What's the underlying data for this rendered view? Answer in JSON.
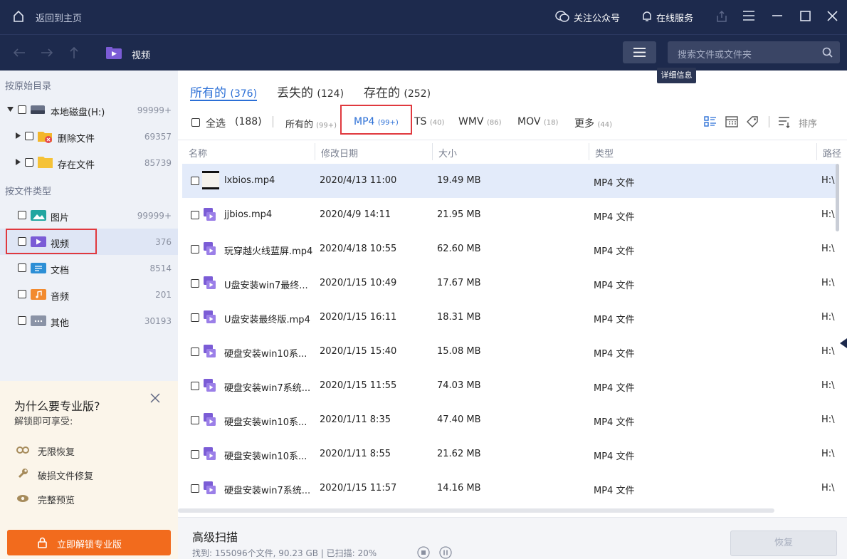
{
  "topbar": {
    "back_home": "返回到主页",
    "follow": "关注公众号",
    "online": "在线服务"
  },
  "navbar": {
    "current": "视频",
    "search_placeholder": "搜索文件或文件夹",
    "tooltip": "详细信息"
  },
  "sidebar": {
    "section_dir": "按原始目录",
    "disk": {
      "label": "本地磁盘(H:)",
      "count": "99999+"
    },
    "deleted": {
      "label": "删除文件",
      "count": "69357"
    },
    "existing": {
      "label": "存在文件",
      "count": "85739"
    },
    "section_type": "按文件类型",
    "types": [
      {
        "label": "图片",
        "count": "99999+"
      },
      {
        "label": "视频",
        "count": "376"
      },
      {
        "label": "文档",
        "count": "8514"
      },
      {
        "label": "音频",
        "count": "201"
      },
      {
        "label": "其他",
        "count": "30193"
      }
    ]
  },
  "promo": {
    "title": "为什么要专业版?",
    "subtitle": "解锁即可享受:",
    "features": [
      "无限恢复",
      "破损文件修复",
      "完整预览"
    ],
    "button": "立即解锁专业版"
  },
  "tabs": [
    {
      "label": "所有的",
      "count": "(376)"
    },
    {
      "label": "丢失的",
      "count": "(124)"
    },
    {
      "label": "存在的",
      "count": "(252)"
    }
  ],
  "filters": {
    "select_all": "全选",
    "select_count": "(188)",
    "items": [
      {
        "label": "所有的",
        "count": "(99+)"
      },
      {
        "label": "MP4",
        "count": "(99+)"
      },
      {
        "label": "TS",
        "count": "(40)"
      },
      {
        "label": "WMV",
        "count": "(86)"
      },
      {
        "label": "MOV",
        "count": "(18)"
      },
      {
        "label": "更多",
        "count": "(44)"
      }
    ],
    "sort": "排序"
  },
  "table": {
    "headers": [
      "名称",
      "修改日期",
      "大小",
      "类型",
      "路径"
    ],
    "rows": [
      {
        "name": "lxbios.mp4",
        "date": "2020/4/13 11:00",
        "size": "19.49 MB",
        "type": "MP4 文件",
        "path": "H:\\"
      },
      {
        "name": "jjbios.mp4",
        "date": "2020/4/9 14:11",
        "size": "21.95 MB",
        "type": "MP4 文件",
        "path": "H:\\"
      },
      {
        "name": "玩穿越火线蓝屏.mp4",
        "date": "2020/4/18 10:55",
        "size": "62.60 MB",
        "type": "MP4 文件",
        "path": "H:\\"
      },
      {
        "name": "U盘安装win7最终...",
        "date": "2020/1/15 10:49",
        "size": "17.67 MB",
        "type": "MP4 文件",
        "path": "H:\\"
      },
      {
        "name": "U盘安装最终版.mp4",
        "date": "2020/1/15 16:11",
        "size": "18.31 MB",
        "type": "MP4 文件",
        "path": "H:\\"
      },
      {
        "name": "硬盘安装win10系...",
        "date": "2020/1/15 15:40",
        "size": "15.08 MB",
        "type": "MP4 文件",
        "path": "H:\\"
      },
      {
        "name": "硬盘安装win7系统...",
        "date": "2020/1/15 11:55",
        "size": "74.03 MB",
        "type": "MP4 文件",
        "path": "H:\\"
      },
      {
        "name": "硬盘安装win10系...",
        "date": "2020/1/11 8:35",
        "size": "47.40 MB",
        "type": "MP4 文件",
        "path": "H:\\"
      },
      {
        "name": "硬盘安装win10系...",
        "date": "2020/1/11 8:55",
        "size": "21.62 MB",
        "type": "MP4 文件",
        "path": "H:\\"
      },
      {
        "name": "硬盘安装win7系统...",
        "date": "2020/1/15 11:57",
        "size": "14.16 MB",
        "type": "MP4 文件",
        "path": "H:\\"
      }
    ]
  },
  "footer": {
    "title": "高级扫描",
    "status": "找到: 155096个文件, 90.23 GB | 已扫描: 20%",
    "recover": "恢复"
  },
  "colors": {
    "navy": "#1d2a4d",
    "accent": "#2b6fd6",
    "orange": "#f26b1d",
    "highlight": "#e0393e"
  }
}
